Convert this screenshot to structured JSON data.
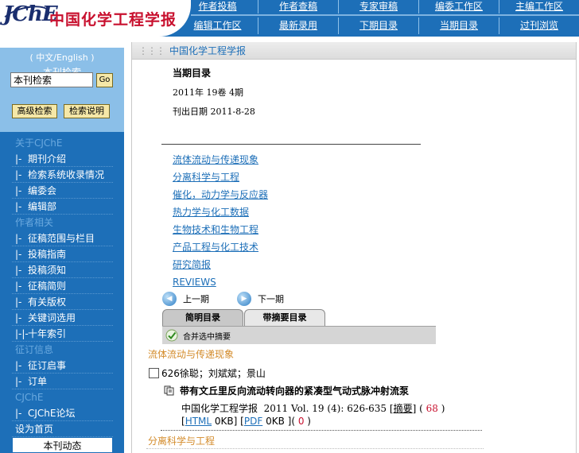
{
  "header": {
    "logo_mark": "JChE",
    "logo_title": "中国化学工程学报",
    "nav_row1": [
      "作者投稿",
      "作者查稿",
      "专家审稿",
      "编委工作区",
      "主编工作区"
    ],
    "nav_row2": [
      "编辑工作区",
      "最新录用",
      "下期目录",
      "当期目录",
      "过刊浏览"
    ]
  },
  "sidebar": {
    "lang": "( 中文/English )",
    "search_title": "本刊检索",
    "search_value": "本刊检索",
    "go_label": "Go",
    "advanced_label": "高级检索",
    "help_label": "检索说明",
    "sections": [
      {
        "title": "关于CJChE",
        "items": [
          "期刊介绍",
          "检索系统收录情况",
          "编委会",
          "编辑部"
        ]
      },
      {
        "title": "作者相关",
        "items": [
          "征稿范围与栏目",
          "投稿指南",
          "投稿须知",
          "征稿简则",
          "有关版权",
          "关键词选用",
          "十年索引"
        ]
      },
      {
        "title": "征订信息",
        "items": [
          "征订启事",
          "订单"
        ]
      },
      {
        "title": "CJChE",
        "items": [
          "CJChE论坛"
        ]
      }
    ],
    "homepage": "设为首页",
    "dongtai": "本刊动态",
    "link_prefix": "|-",
    "link_prefix_index": "|-|-"
  },
  "main": {
    "head_title": "中国化学工程学报",
    "issue_label": "当期目录",
    "issue_info": "2011年 19卷 4期",
    "issue_date_label": "刊出日期",
    "issue_date": "2011-8-28",
    "categories": [
      "流体流动与传递现象",
      "分离科学与工程",
      "催化，动力学与反应器",
      "热力学与化工数据",
      "生物技术和生物工程",
      "产品工程与化工技术",
      "研究简报",
      "REVIEWS"
    ],
    "prev_label": "上一期",
    "next_label": "下一期",
    "tab_brief": "简明目录",
    "tab_abstract": "带摘要目录",
    "merge_label": "合并选中摘要",
    "section1": "流体流动与传递现象",
    "article": {
      "authors": "626徐聪；刘斌斌；景山",
      "title": "带有文丘里反向流动转向器的紧凑型气动式脉冲射流泵",
      "journal": "中国化学工程学报",
      "citation": "2011 Vol. 19 (4): 626-635",
      "abstract_link": "摘要",
      "abstract_count": "68",
      "html_link": "HTML",
      "html_size": "0KB",
      "pdf_link": "PDF",
      "pdf_size": "0KB",
      "download_count": "0"
    },
    "section2": "分离科学与工程"
  },
  "colors": {
    "nav_blue": "#1d6fb8",
    "accent_red": "#c8102e",
    "section_orange": "#d38b2a",
    "button_yellow": "#f5e8a8"
  },
  "icons": [
    "circle-left-icon",
    "circle-right-icon",
    "checkmark-icon",
    "document-icon"
  ]
}
